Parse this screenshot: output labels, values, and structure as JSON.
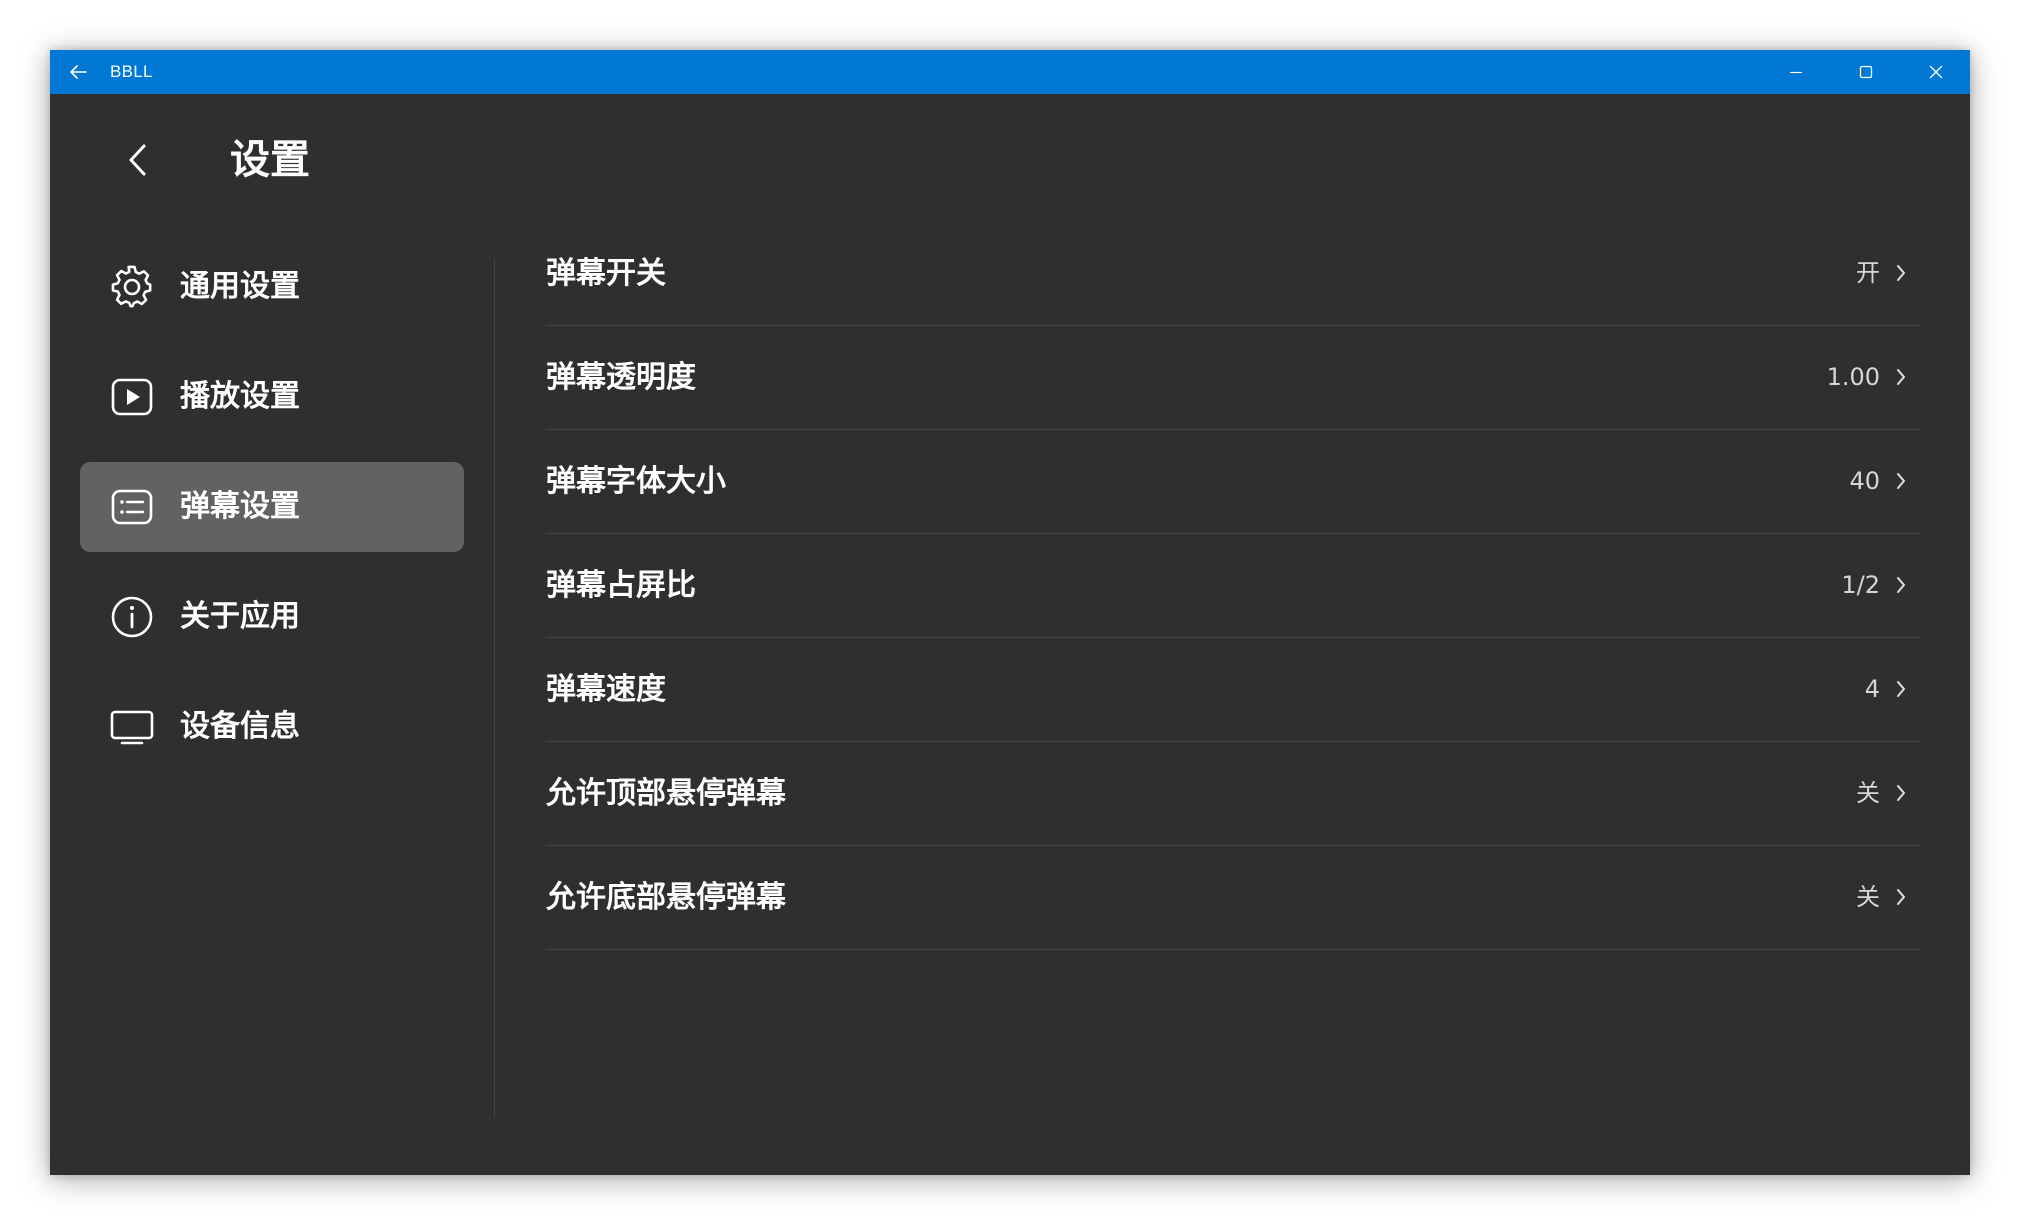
{
  "window": {
    "title": "BBLL",
    "icons": {
      "back": "arrow-left-icon",
      "minimize": "minimize-icon",
      "maximize": "maximize-icon",
      "close": "close-icon"
    },
    "accent_color": "#0078d4",
    "background_color": "#2f2f2f"
  },
  "header": {
    "title": "设置",
    "back_icon": "chevron-left-icon"
  },
  "sidebar": {
    "items": [
      {
        "label": "通用设置",
        "icon": "gear-icon",
        "active": false
      },
      {
        "label": "播放设置",
        "icon": "play-icon",
        "active": false
      },
      {
        "label": "弹幕设置",
        "icon": "danmaku-icon",
        "active": true
      },
      {
        "label": "关于应用",
        "icon": "info-icon",
        "active": false
      },
      {
        "label": "设备信息",
        "icon": "monitor-icon",
        "active": false
      }
    ],
    "active_color": "#626262"
  },
  "settings": {
    "rows": [
      {
        "label": "弹幕开关",
        "value": "开"
      },
      {
        "label": "弹幕透明度",
        "value": "1.00"
      },
      {
        "label": "弹幕字体大小",
        "value": "40"
      },
      {
        "label": "弹幕占屏比",
        "value": "1/2"
      },
      {
        "label": "弹幕速度",
        "value": "4"
      },
      {
        "label": "允许顶部悬停弹幕",
        "value": "关"
      },
      {
        "label": "允许底部悬停弹幕",
        "value": "关"
      }
    ],
    "chevron_icon": "chevron-right-icon"
  }
}
